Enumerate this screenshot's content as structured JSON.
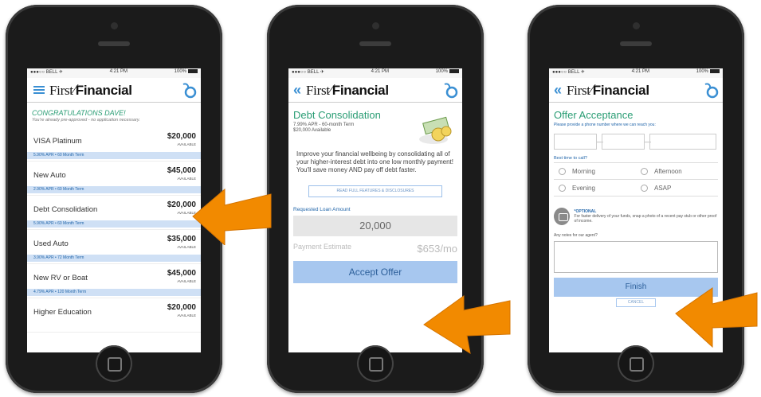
{
  "colors": {
    "accent_blue": "#3a8fd3",
    "green": "#2a9d74",
    "arrow": "#f28a00",
    "button_blue": "#a7c7ef"
  },
  "status_bar": {
    "carrier": "●●●○○ BELL ✈",
    "time": "4:21 PM",
    "battery": "100%"
  },
  "brand": {
    "first": "First",
    "financial": "Financial"
  },
  "screen1": {
    "congrats": "CONGRATULATIONS DAVE!",
    "subtitle": "You're already pre-approved - no application necessary.",
    "loans": [
      {
        "name": "VISA Platinum",
        "amount": "$20,000",
        "avail": "AVAILABLE",
        "terms": "5.90% APR  •  60 Month Term"
      },
      {
        "name": "New Auto",
        "amount": "$45,000",
        "avail": "AVAILABLE",
        "terms": "2.90% APR  •  60 Month Term"
      },
      {
        "name": "Debt Consolidation",
        "amount": "$20,000",
        "avail": "AVAILABLE",
        "terms": "5.90% APR  •  60 Month Term"
      },
      {
        "name": "Used Auto",
        "amount": "$35,000",
        "avail": "AVAILABLE",
        "terms": "3.90% APR  •  72 Month Term"
      },
      {
        "name": "New RV or Boat",
        "amount": "$45,000",
        "avail": "AVAILABLE",
        "terms": "4.79% APR  •  120 Month Term"
      },
      {
        "name": "Higher Education",
        "amount": "$20,000",
        "avail": "AVAILABLE",
        "terms": ""
      }
    ]
  },
  "screen2": {
    "title": "Debt Consolidation",
    "apr": "7.99% APR - 60-month Term",
    "available": "$20,000 Available",
    "body": "Improve your financial wellbeing by consolidating all of your higher-interest debt into one low monthly payment! You'll save money AND pay off debt faster.",
    "read_link": "READ FULL FEATURES & DISCLOSURES",
    "requested_label": "Requested Loan Amount",
    "amount": "20,000",
    "payment_label": "Payment Estimate",
    "payment_value": "$653/mo",
    "accept_button": "Accept Offer"
  },
  "screen3": {
    "title": "Offer Acceptance",
    "phone_prompt": "Please provide a phone number where we can reach you:",
    "best_time_label": "Best time to call?",
    "options": [
      "Morning",
      "Afternoon",
      "Evening",
      "ASAP"
    ],
    "optional_label": "*OPTIONAL",
    "optional_text": "For faster delivery of your funds, snap a photo of a recent pay stub or other proof of income.",
    "notes_label": "Any notes for our agent?",
    "finish_button": "Finish",
    "cancel_button": "CANCEL"
  }
}
